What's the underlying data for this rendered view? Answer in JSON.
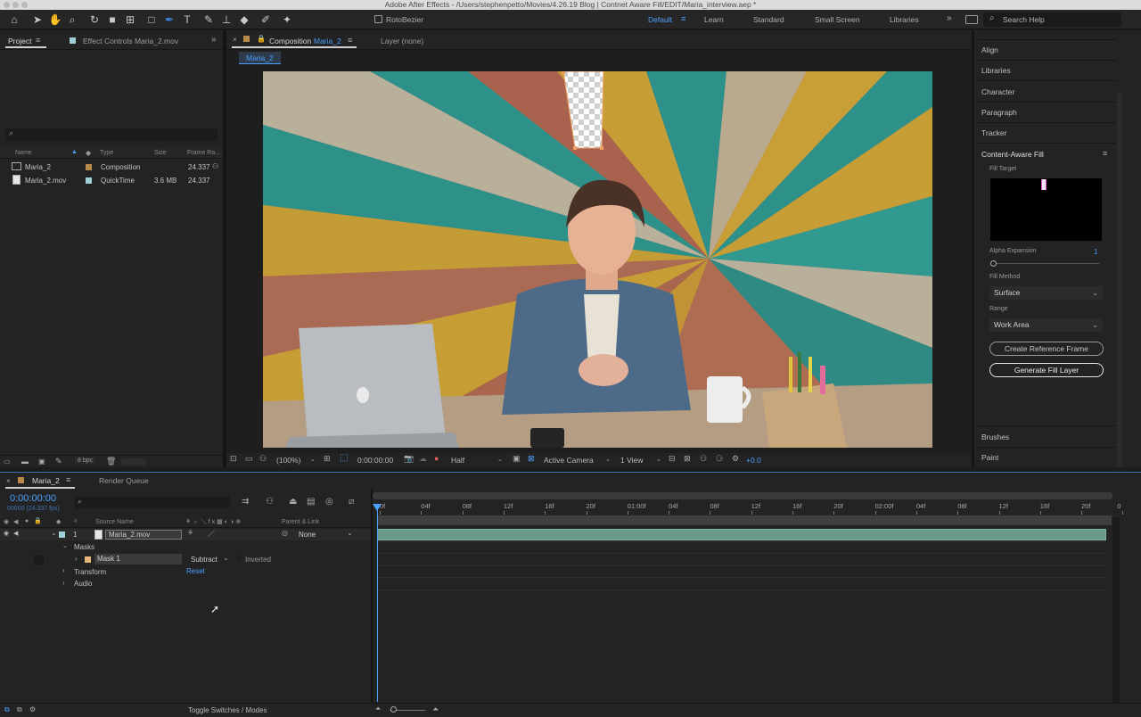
{
  "window": {
    "title": "Adobe After Effects - /Users/stephenpetto/Movies/4.26.19 Blog | Contnet Aware Fill/EDIT/Maria_interview.aep *"
  },
  "toolbar": {
    "rotobezier_label": "RotoBezier",
    "workspaces": [
      "Default",
      "Learn",
      "Standard",
      "Small Screen",
      "Libraries"
    ],
    "active_workspace": "Default",
    "search_placeholder": "Search Help",
    "accent_color": "#4aa0ff"
  },
  "project_panel": {
    "tab_project": "Project",
    "tab_effect_controls": "Effect Controls Maria_2.mov",
    "columns": [
      "Name",
      "Type",
      "Size",
      "Frame Ra..."
    ],
    "items": [
      {
        "name": "Maria_2",
        "type": "Composition",
        "size": "",
        "frame_rate": "24.337",
        "color": "#b8894a"
      },
      {
        "name": "Maria_2.mov",
        "type": "QuickTime",
        "size": "3.6 MB",
        "frame_rate": "24.337",
        "color": "#9fd0d8"
      }
    ],
    "bpc": "8 bpc"
  },
  "composition_panel": {
    "tab_label_prefix": "Composition",
    "tab_comp_name": "Maria_2",
    "tab_layer": "Layer (none)",
    "breadcrumb": "Maria_2",
    "zoom": "(100%)",
    "timecode": "0:00:00:00",
    "resolution": "Half",
    "camera": "Active Camera",
    "views": "1 View",
    "exposure": "+0.0"
  },
  "right_panel": {
    "items": [
      "Align",
      "Libraries",
      "Character",
      "Paragraph",
      "Tracker"
    ],
    "caf_title": "Content-Aware Fill",
    "fill_target_label": "Fill Target",
    "alpha_expansion_label": "Alpha Expansion",
    "alpha_expansion_value": "1",
    "fill_method_label": "Fill Method",
    "fill_method_value": "Surface",
    "range_label": "Range",
    "range_value": "Work Area",
    "create_reference_button": "Create Reference Frame",
    "generate_fill_button": "Generate Fill Layer",
    "bottom_items": [
      "Brushes",
      "Paint"
    ]
  },
  "timeline": {
    "tab_comp": "Maria_2",
    "tab_render": "Render Queue",
    "timecode": "0:00:00:00",
    "fps_text": "00000 (24.337 fps)",
    "header_source": "Source Name",
    "header_parent": "Parent & Link",
    "layer_number": "1",
    "layer_name": "Maria_2.mov",
    "parent_value": "None",
    "masks_label": "Masks",
    "mask_name": "Mask 1",
    "mask_mode": "Subtract",
    "inverted_label": "Inverted",
    "transform_label": "Transform",
    "reset_label": "Reset",
    "audio_label": "Audio",
    "toggle_label": "Toggle Switches / Modes",
    "ruler": [
      "0f",
      "04f",
      "08f",
      "12f",
      "16f",
      "20f",
      "01:00f",
      "04f",
      "08f",
      "12f",
      "16f",
      "20f",
      "02:00f",
      "04f",
      "08f",
      "12f",
      "16f",
      "20f",
      "0"
    ]
  }
}
